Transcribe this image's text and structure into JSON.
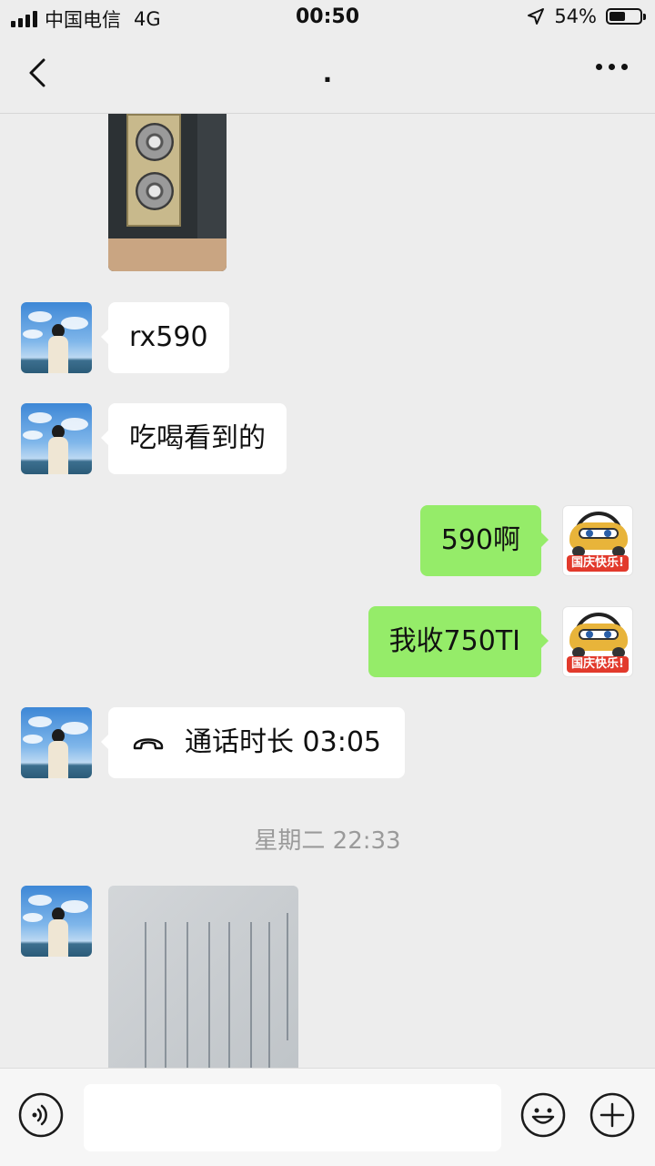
{
  "status_bar": {
    "carrier": "中国电信",
    "network": "4G",
    "time": "00:50",
    "battery_percent": "54%",
    "battery_level": 0.54
  },
  "nav": {
    "title": ".",
    "back_icon": "chevron-left-icon",
    "more_icon": "more-dots-icon"
  },
  "messages": [
    {
      "side": "incoming",
      "type": "image",
      "content": "graphics card photo"
    },
    {
      "side": "incoming",
      "type": "text",
      "text": "rx590"
    },
    {
      "side": "incoming",
      "type": "text",
      "text": "吃喝看到的"
    },
    {
      "side": "outgoing",
      "type": "text",
      "text": "590啊",
      "avatar_badge": "国庆快乐!"
    },
    {
      "side": "outgoing",
      "type": "text",
      "text": "我收750TI",
      "avatar_badge": "国庆快乐!"
    },
    {
      "side": "incoming",
      "type": "call",
      "text": "通话时长 03:05"
    },
    {
      "side": "incoming",
      "type": "image",
      "content": "system specs photo"
    }
  ],
  "timestamp": "星期二 22:33",
  "bottom_bar": {
    "voice_icon": "voice-icon",
    "emoji_icon": "emoji-icon",
    "plus_icon": "plus-icon",
    "input_value": ""
  },
  "colors": {
    "background": "#ededed",
    "outgoing_bubble": "#95ec69",
    "incoming_bubble": "#ffffff",
    "timestamp": "#9a9a9a"
  }
}
